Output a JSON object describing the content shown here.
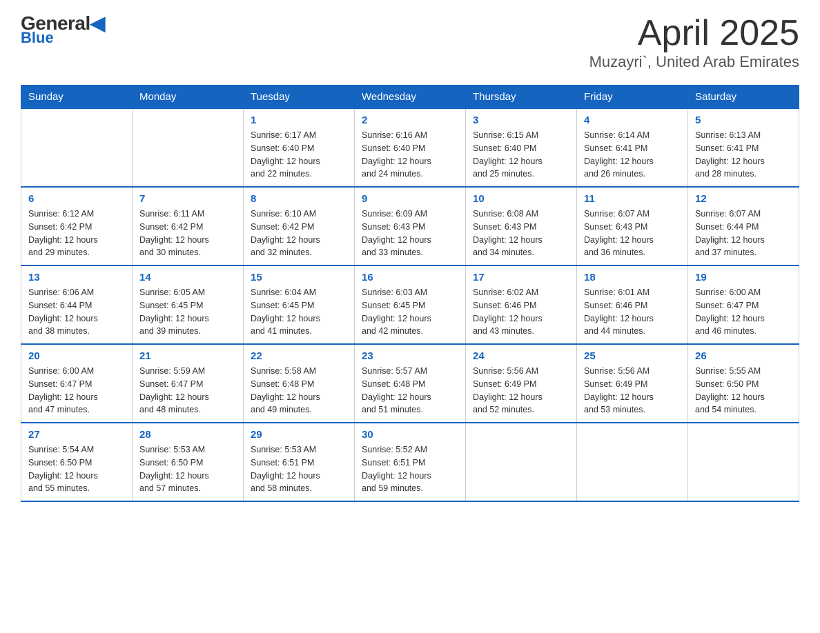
{
  "header": {
    "logo_top": "General",
    "logo_bottom": "Blue",
    "title": "April 2025",
    "subtitle": "Muzayri`, United Arab Emirates"
  },
  "weekdays": [
    "Sunday",
    "Monday",
    "Tuesday",
    "Wednesday",
    "Thursday",
    "Friday",
    "Saturday"
  ],
  "weeks": [
    [
      {
        "day": "",
        "info": ""
      },
      {
        "day": "",
        "info": ""
      },
      {
        "day": "1",
        "info": "Sunrise: 6:17 AM\nSunset: 6:40 PM\nDaylight: 12 hours\nand 22 minutes."
      },
      {
        "day": "2",
        "info": "Sunrise: 6:16 AM\nSunset: 6:40 PM\nDaylight: 12 hours\nand 24 minutes."
      },
      {
        "day": "3",
        "info": "Sunrise: 6:15 AM\nSunset: 6:40 PM\nDaylight: 12 hours\nand 25 minutes."
      },
      {
        "day": "4",
        "info": "Sunrise: 6:14 AM\nSunset: 6:41 PM\nDaylight: 12 hours\nand 26 minutes."
      },
      {
        "day": "5",
        "info": "Sunrise: 6:13 AM\nSunset: 6:41 PM\nDaylight: 12 hours\nand 28 minutes."
      }
    ],
    [
      {
        "day": "6",
        "info": "Sunrise: 6:12 AM\nSunset: 6:42 PM\nDaylight: 12 hours\nand 29 minutes."
      },
      {
        "day": "7",
        "info": "Sunrise: 6:11 AM\nSunset: 6:42 PM\nDaylight: 12 hours\nand 30 minutes."
      },
      {
        "day": "8",
        "info": "Sunrise: 6:10 AM\nSunset: 6:42 PM\nDaylight: 12 hours\nand 32 minutes."
      },
      {
        "day": "9",
        "info": "Sunrise: 6:09 AM\nSunset: 6:43 PM\nDaylight: 12 hours\nand 33 minutes."
      },
      {
        "day": "10",
        "info": "Sunrise: 6:08 AM\nSunset: 6:43 PM\nDaylight: 12 hours\nand 34 minutes."
      },
      {
        "day": "11",
        "info": "Sunrise: 6:07 AM\nSunset: 6:43 PM\nDaylight: 12 hours\nand 36 minutes."
      },
      {
        "day": "12",
        "info": "Sunrise: 6:07 AM\nSunset: 6:44 PM\nDaylight: 12 hours\nand 37 minutes."
      }
    ],
    [
      {
        "day": "13",
        "info": "Sunrise: 6:06 AM\nSunset: 6:44 PM\nDaylight: 12 hours\nand 38 minutes."
      },
      {
        "day": "14",
        "info": "Sunrise: 6:05 AM\nSunset: 6:45 PM\nDaylight: 12 hours\nand 39 minutes."
      },
      {
        "day": "15",
        "info": "Sunrise: 6:04 AM\nSunset: 6:45 PM\nDaylight: 12 hours\nand 41 minutes."
      },
      {
        "day": "16",
        "info": "Sunrise: 6:03 AM\nSunset: 6:45 PM\nDaylight: 12 hours\nand 42 minutes."
      },
      {
        "day": "17",
        "info": "Sunrise: 6:02 AM\nSunset: 6:46 PM\nDaylight: 12 hours\nand 43 minutes."
      },
      {
        "day": "18",
        "info": "Sunrise: 6:01 AM\nSunset: 6:46 PM\nDaylight: 12 hours\nand 44 minutes."
      },
      {
        "day": "19",
        "info": "Sunrise: 6:00 AM\nSunset: 6:47 PM\nDaylight: 12 hours\nand 46 minutes."
      }
    ],
    [
      {
        "day": "20",
        "info": "Sunrise: 6:00 AM\nSunset: 6:47 PM\nDaylight: 12 hours\nand 47 minutes."
      },
      {
        "day": "21",
        "info": "Sunrise: 5:59 AM\nSunset: 6:47 PM\nDaylight: 12 hours\nand 48 minutes."
      },
      {
        "day": "22",
        "info": "Sunrise: 5:58 AM\nSunset: 6:48 PM\nDaylight: 12 hours\nand 49 minutes."
      },
      {
        "day": "23",
        "info": "Sunrise: 5:57 AM\nSunset: 6:48 PM\nDaylight: 12 hours\nand 51 minutes."
      },
      {
        "day": "24",
        "info": "Sunrise: 5:56 AM\nSunset: 6:49 PM\nDaylight: 12 hours\nand 52 minutes."
      },
      {
        "day": "25",
        "info": "Sunrise: 5:56 AM\nSunset: 6:49 PM\nDaylight: 12 hours\nand 53 minutes."
      },
      {
        "day": "26",
        "info": "Sunrise: 5:55 AM\nSunset: 6:50 PM\nDaylight: 12 hours\nand 54 minutes."
      }
    ],
    [
      {
        "day": "27",
        "info": "Sunrise: 5:54 AM\nSunset: 6:50 PM\nDaylight: 12 hours\nand 55 minutes."
      },
      {
        "day": "28",
        "info": "Sunrise: 5:53 AM\nSunset: 6:50 PM\nDaylight: 12 hours\nand 57 minutes."
      },
      {
        "day": "29",
        "info": "Sunrise: 5:53 AM\nSunset: 6:51 PM\nDaylight: 12 hours\nand 58 minutes."
      },
      {
        "day": "30",
        "info": "Sunrise: 5:52 AM\nSunset: 6:51 PM\nDaylight: 12 hours\nand 59 minutes."
      },
      {
        "day": "",
        "info": ""
      },
      {
        "day": "",
        "info": ""
      },
      {
        "day": "",
        "info": ""
      }
    ]
  ]
}
